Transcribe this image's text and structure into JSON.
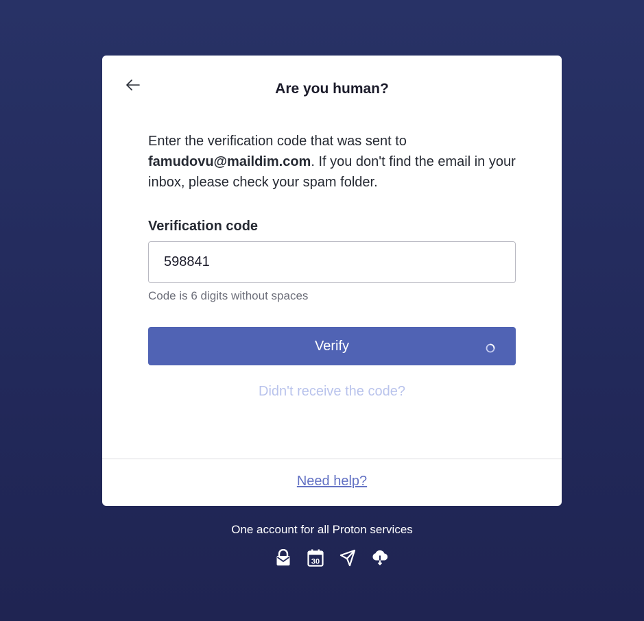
{
  "card": {
    "title": "Are you human?",
    "intro_before": "Enter the verification code that was sent to",
    "email": "famudovu@maildim.com",
    "intro_after": ". If you don't find the email in your inbox, please check your spam folder.",
    "field_label": "Verification code",
    "code_value": "598841",
    "hint": "Code is 6 digits without spaces",
    "verify_label": "Verify",
    "resend_link": "Didn't receive the code?",
    "help_link": "Need help?"
  },
  "footer": {
    "tagline": "One account for all Proton services",
    "services": [
      "mail-lock-icon",
      "calendar-icon",
      "send-icon",
      "cloud-drive-icon"
    ],
    "calendar_day": "30"
  },
  "icons": {
    "back": "arrow-left-icon",
    "spinner": "loading-spinner-icon"
  },
  "colors": {
    "background": "#262f63",
    "primary": "#5063b4",
    "link": "#6372c4",
    "disabled_link": "#b9c3ec"
  }
}
